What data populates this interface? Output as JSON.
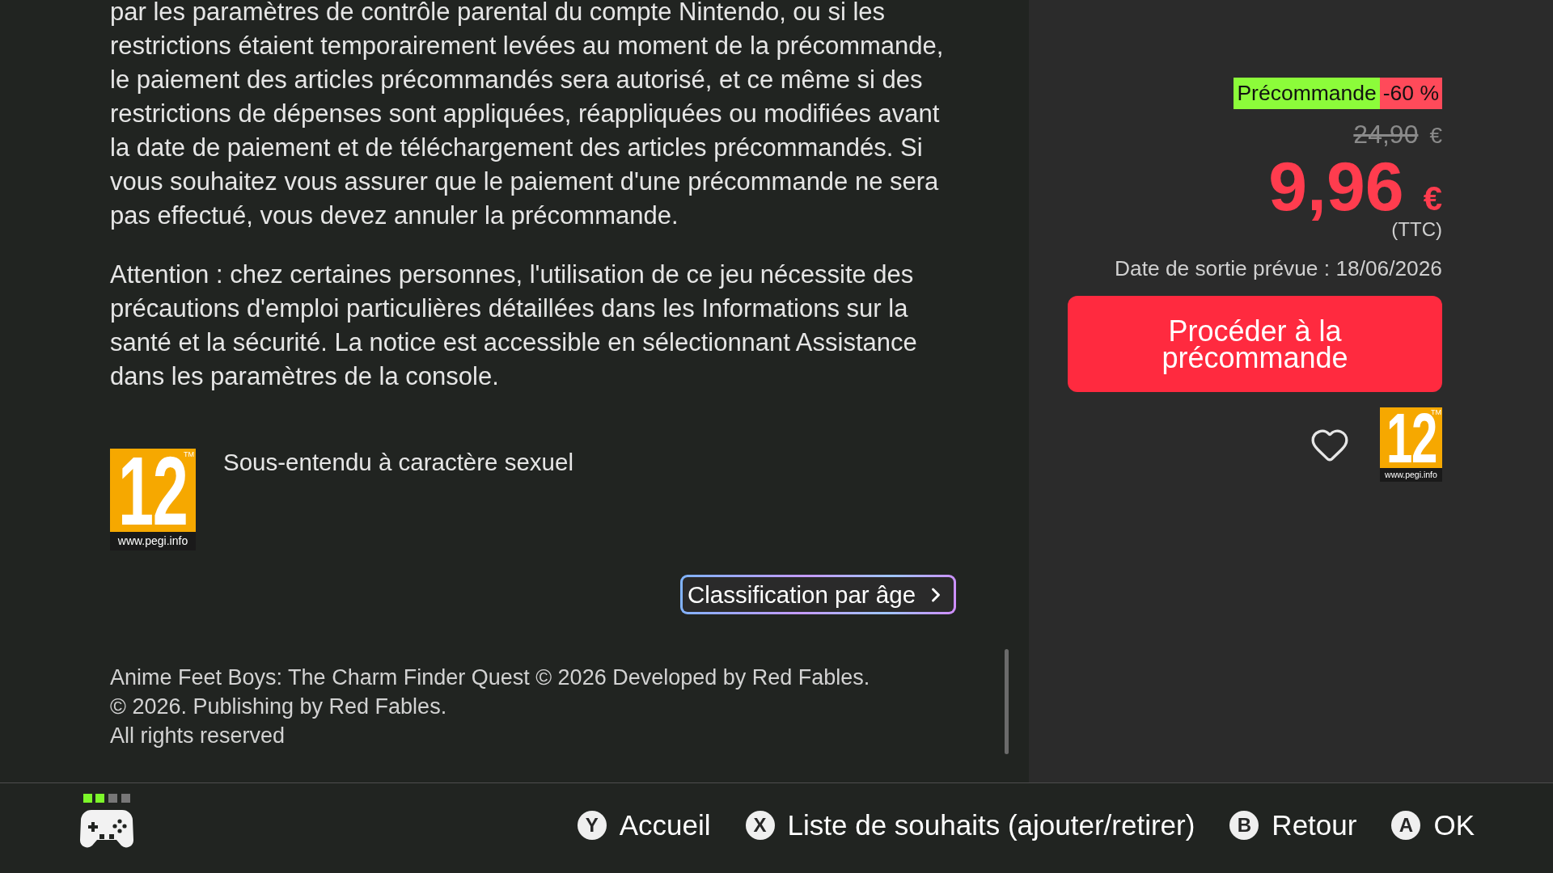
{
  "description": {
    "paragraphs": [
      "par les paramètres de contrôle parental du compte Nintendo, ou si les restrictions étaient temporairement levées au moment de la précommande, le paiement des articles précommandés sera autorisé, et ce même si des restrictions de dépenses sont appliquées, réappliquées ou modifiées avant la date de paiement et de téléchargement des articles précommandés. Si vous souhaitez vous assurer que le paiement d'une précommande ne sera pas effectué, vous devez annuler la précommande.",
      "Attention : chez certaines personnes, l'utilisation de ce jeu nécessite des précautions d'emploi particulières détaillées dans les Informations sur la santé et la sécurité. La notice est accessible en sélectionnant Assistance dans les paramètres de la console."
    ]
  },
  "content_rating": {
    "logo": {
      "age": "12",
      "trademark": "TM",
      "site": "www.pegi.info"
    },
    "descriptors": [
      "Sous-entendu à caractère sexuel"
    ]
  },
  "rating_link": {
    "label": "Classification par âge"
  },
  "copyright": [
    "Anime Feet Boys: The Charm Finder Quest © 2026 Developed by Red Fables.",
    "© 2026. Publishing by Red Fables.",
    "All rights reserved"
  ],
  "purchase": {
    "tags": [
      {
        "kind": "preorder",
        "label": "Précommande"
      },
      {
        "kind": "discount",
        "label": "-60 %"
      }
    ],
    "original_price": {
      "amount": "24,90",
      "currency": "€"
    },
    "price": {
      "amount": "9,96",
      "currency": "€"
    },
    "tax_note": "(TTC)",
    "release_date": "Date de sortie prévue : 18/06/2026",
    "button": "Procéder à la précommande",
    "wishlisted": false,
    "rating_logo": {
      "age": "12",
      "trademark": "TM",
      "site": "www.pegi.info"
    }
  },
  "footer": {
    "actions": [
      {
        "key": "Y",
        "label": "Accueil"
      },
      {
        "key": "X",
        "label": "Liste de souhaits (ajouter/retirer)"
      },
      {
        "key": "B",
        "label": "Retour"
      },
      {
        "key": "A",
        "label": "OK"
      }
    ]
  }
}
